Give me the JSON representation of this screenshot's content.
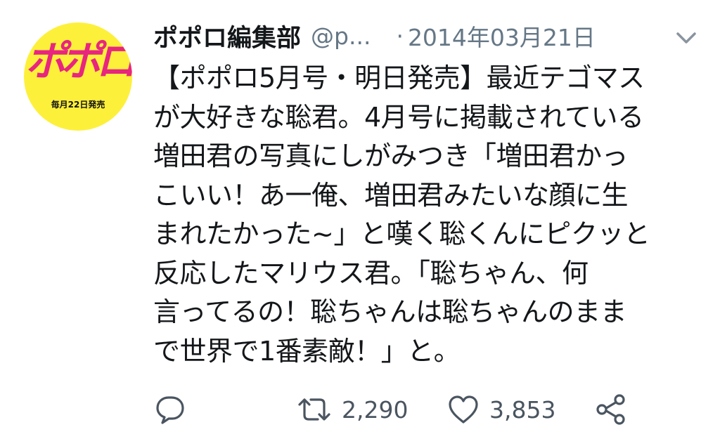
{
  "tweet": {
    "avatar": {
      "logo_text": "ポポロ",
      "sub_text": "毎月22日発売"
    },
    "display_name": "ポポロ編集部",
    "handle": "@p...",
    "separator": "·",
    "date": "2014年03月21日",
    "text": "【ポポロ5月号・明日発売】最近テゴマス\nが大好きな聡君。4月号に掲載されている\n増田君の写真にしがみつき「増田君かっ\nこいい！あ一俺、増田君みたいな顔に生\nまれたかった~」と嘆く聡くんにピクッと\n反応したマリウス君。「聡ちゃん、何\n言ってるの！聡ちゃんは聡ちゃんのまま\nで世界で1番素敵！」と。",
    "actions": {
      "reply_icon": "reply-icon",
      "retweet_icon": "retweet-icon",
      "retweet_count": "2,290",
      "like_icon": "heart-icon",
      "like_count": "3,853",
      "share_icon": "share-icon"
    },
    "menu_icon": "chevron-down-icon"
  },
  "colors": {
    "avatar_bg": "#fdf03a",
    "avatar_logo": "#e8257f",
    "text": "#14171a",
    "secondary": "#657786",
    "icon": "#4a5560"
  }
}
